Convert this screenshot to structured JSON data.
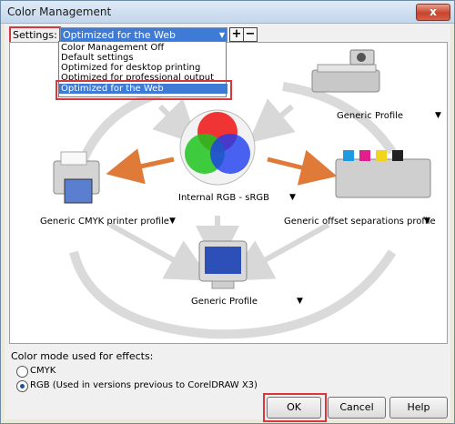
{
  "window": {
    "title": "Color Management",
    "close_label": "x"
  },
  "settings": {
    "label": "Settings:",
    "selected": "Optimized for the Web",
    "add_label": "+",
    "remove_label": "−",
    "options": [
      "Color Management Off",
      "Default settings",
      "Optimized for desktop printing",
      "Optimized for professional output",
      "Optimized for the Web"
    ]
  },
  "profiles": {
    "scanner": "Generic Profile",
    "internal": "Internal RGB - sRGB",
    "printer": "Generic CMYK printer profile",
    "offset": "Generic offset separations profile",
    "monitor": "Generic Profile"
  },
  "effects": {
    "label": "Color mode used for effects:",
    "cmyk": "CMYK",
    "rgb": "RGB (Used in versions previous to CorelDRAW X3)",
    "selected": "RGB"
  },
  "buttons": {
    "ok": "OK",
    "cancel": "Cancel",
    "help": "Help"
  },
  "colors": {
    "accent": "#3d7bd6",
    "arrow": "#e07a38",
    "highlight": "#d9363e"
  }
}
